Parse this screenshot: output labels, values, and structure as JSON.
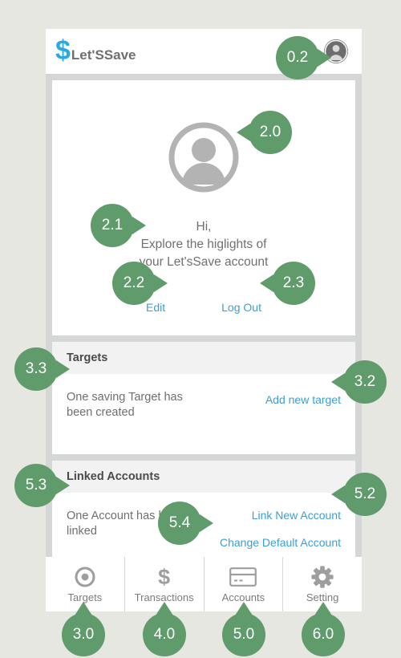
{
  "theme": {
    "page_background": "#e6e7e1",
    "frame": "#d5d7d6",
    "card": "#ffffff",
    "section_header_bg": "#f2f2f2",
    "accent_link": "#3b9fd4",
    "logo_blue": "#29abe2",
    "callout_green": "#5f9b6b",
    "text_gray": "#6f6f6f",
    "icon_gray": "#b3b3b3"
  },
  "header": {
    "logo_symbol": "$",
    "logo_text": "Let'SSave",
    "avatar_icon": "account-circle-icon"
  },
  "profile": {
    "avatar_icon": "person-circle-icon",
    "greeting_line1": "Hi,",
    "greeting_line2": "Explore the higlights of",
    "greeting_line3": "your Let'sSave account",
    "edit_label": "Edit",
    "logout_label": "Log Out"
  },
  "targets_section": {
    "header": "Targets",
    "status_text": "One saving Target has been created",
    "add_link": "Add new target"
  },
  "accounts_section": {
    "header": "Linked Accounts",
    "status_text": "One Account has been linked",
    "link_new_label": "Link New Account",
    "change_default_label": "Change Default Account"
  },
  "bottom_nav": {
    "items": [
      {
        "label": "Targets",
        "icon": "target-icon"
      },
      {
        "label": "Transactions",
        "icon": "dollar-icon"
      },
      {
        "label": "Accounts",
        "icon": "credit-card-icon"
      },
      {
        "label": "Setting",
        "icon": "gear-icon"
      }
    ]
  },
  "callouts": [
    {
      "id": "0.2",
      "label": "0.2",
      "points_to": "header-avatar",
      "direction": "right"
    },
    {
      "id": "2.0",
      "label": "2.0",
      "points_to": "profile-avatar",
      "direction": "left"
    },
    {
      "id": "2.1",
      "label": "2.1",
      "points_to": "greeting-text",
      "direction": "right"
    },
    {
      "id": "2.2",
      "label": "2.2",
      "points_to": "edit-link",
      "direction": "right"
    },
    {
      "id": "2.3",
      "label": "2.3",
      "points_to": "logout-link",
      "direction": "left"
    },
    {
      "id": "3.3",
      "label": "3.3",
      "points_to": "targets-status",
      "direction": "right"
    },
    {
      "id": "3.2",
      "label": "3.2",
      "points_to": "add-new-target-link",
      "direction": "left"
    },
    {
      "id": "5.3",
      "label": "5.3",
      "points_to": "accounts-status",
      "direction": "right"
    },
    {
      "id": "5.2",
      "label": "5.2",
      "points_to": "link-new-account-link",
      "direction": "left"
    },
    {
      "id": "5.4",
      "label": "5.4",
      "points_to": "change-default-account-link",
      "direction": "right"
    },
    {
      "id": "3.0",
      "label": "3.0",
      "points_to": "nav-targets",
      "direction": "up"
    },
    {
      "id": "4.0",
      "label": "4.0",
      "points_to": "nav-transactions",
      "direction": "up"
    },
    {
      "id": "5.0",
      "label": "5.0",
      "points_to": "nav-accounts",
      "direction": "up"
    },
    {
      "id": "6.0",
      "label": "6.0",
      "points_to": "nav-setting",
      "direction": "up"
    }
  ]
}
